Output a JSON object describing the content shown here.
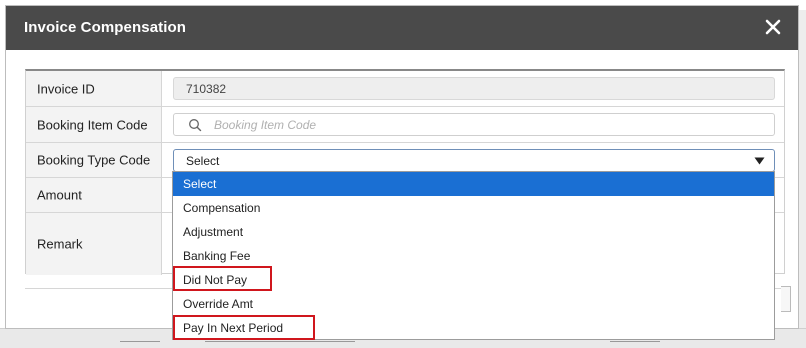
{
  "dialog": {
    "title": "Invoice Compensation"
  },
  "form": {
    "invoice_id": {
      "label": "Invoice ID",
      "value": "710382"
    },
    "booking_item_code": {
      "label": "Booking Item Code",
      "placeholder": "Booking Item Code"
    },
    "booking_type_code": {
      "label": "Booking Type Code",
      "selected": "Select"
    },
    "amount": {
      "label": "Amount"
    },
    "remark": {
      "label": "Remark"
    }
  },
  "dropdown": {
    "options": [
      "Select",
      "Compensation",
      "Adjustment",
      "Banking Fee",
      "Did Not Pay",
      "Override Amt",
      "Pay In Next Period"
    ],
    "highlighted_option": "Select",
    "annotated_options": [
      "Did Not Pay",
      "Pay In Next Period"
    ]
  },
  "colors": {
    "header_bg": "#4a4a4a",
    "selected_option_bg": "#1a6fd3",
    "annotation_red": "#d0161d"
  },
  "icons": {
    "close": "close-icon",
    "search": "search-icon",
    "caret": "caret-down-icon"
  }
}
